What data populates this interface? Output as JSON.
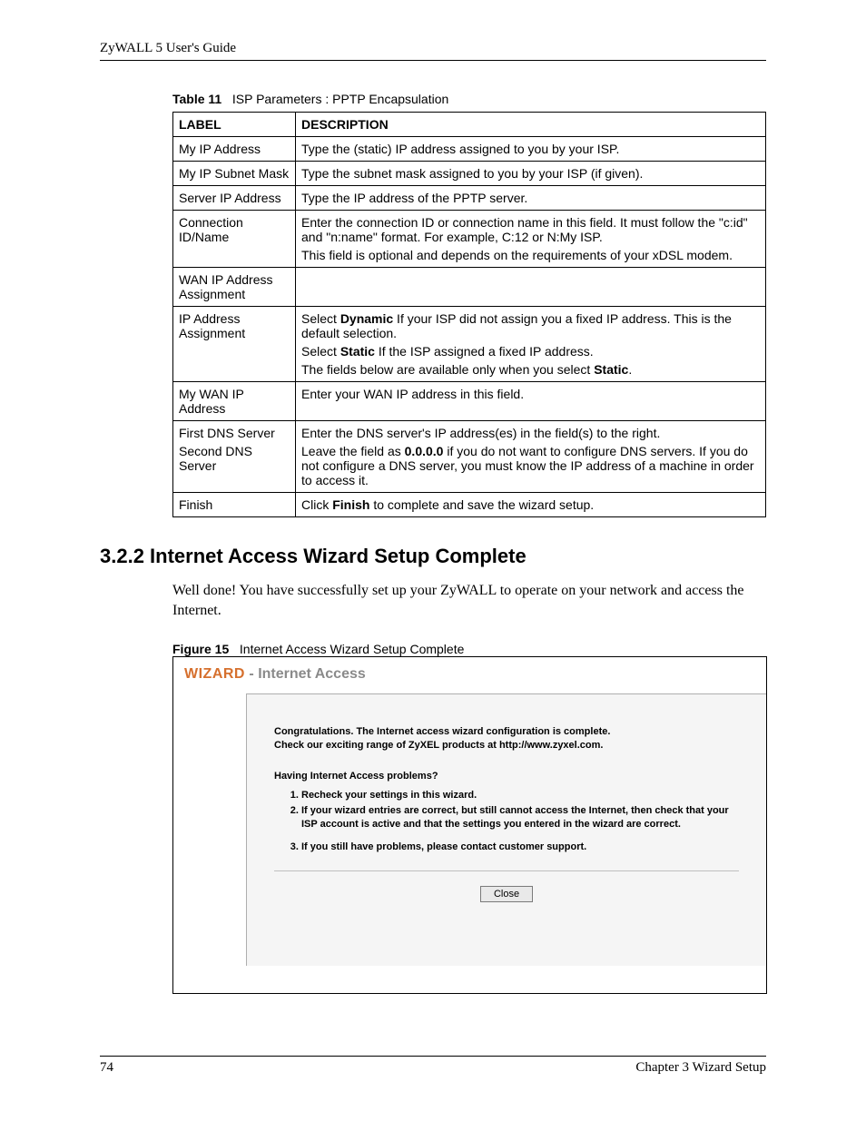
{
  "header": {
    "title": "ZyWALL 5 User's Guide"
  },
  "table": {
    "caption_prefix": "Table 11",
    "caption_text": "ISP Parameters : PPTP Encapsulation",
    "head": {
      "label": "LABEL",
      "desc_d": "D",
      "desc_rest": "ESCRIPTION"
    },
    "rows": {
      "r0": {
        "label": "My IP Address",
        "desc": "Type the (static) IP address assigned to you by your ISP."
      },
      "r1": {
        "label": "My IP Subnet Mask",
        "desc": "Type the subnet mask assigned to you by your ISP (if given)."
      },
      "r2": {
        "label": "Server IP Address",
        "desc": "Type the IP address of the PPTP server."
      },
      "r3": {
        "label": "Connection ID/Name",
        "p1": "Enter the connection ID or connection name in this field. It must follow the \"c:id\" and \"n:name\" format. For example, C:12 or N:My ISP.",
        "p2": "This field is optional and depends on the requirements of your xDSL modem."
      },
      "r4": {
        "label": "WAN IP Address Assignment",
        "desc": ""
      },
      "r5": {
        "label": "IP Address Assignment",
        "p1a": "Select ",
        "p1b": "Dynamic",
        "p1c": " If your ISP did not assign you a fixed IP address. This is the default selection.",
        "p2a": "Select ",
        "p2b": "Static",
        "p2c": " If the ISP assigned a fixed IP address.",
        "p3a": "The fields below are available only when you select ",
        "p3b": "Static",
        "p3c": "."
      },
      "r6": {
        "label": "My WAN IP Address",
        "desc": "Enter your WAN IP address in this field."
      },
      "r7": {
        "label_a": "First DNS Server",
        "label_b": "Second DNS Server",
        "p1": "Enter the DNS server's IP address(es) in the field(s) to the right.",
        "p2a": "Leave the field as ",
        "p2b": "0.0.0.0",
        "p2c": " if you do not want to configure DNS servers. If you do not configure a DNS server, you must know the IP address of a machine in order to access it."
      },
      "r8": {
        "label": "Finish",
        "a": "Click ",
        "b": "Finish",
        "c": " to complete and save the wizard setup."
      }
    }
  },
  "section": {
    "heading": "3.2.2  Internet Access Wizard Setup Complete",
    "body": "Well done! You have successfully set up your ZyWALL to operate on your network and access the Internet."
  },
  "figure": {
    "caption_prefix": "Figure 15",
    "caption_text": "Internet Access Wizard Setup Complete"
  },
  "wizard": {
    "title_a": "WIZARD",
    "title_b": " - Internet Access",
    "line1": "Congratulations. The Internet access wizard configuration is complete.",
    "line2": "Check our exciting range of ZyXEL products at http://www.zyxel.com.",
    "q": "Having Internet Access problems?",
    "li1": "Recheck your settings in this wizard.",
    "li2": "If your wizard entries are correct, but still cannot access the Internet, then check that your ISP account is active and that the settings you entered in the wizard are correct.",
    "li3": "If you still have problems, please contact customer support.",
    "close": "Close"
  },
  "footer": {
    "page": "74",
    "chapter": "Chapter 3 Wizard Setup"
  }
}
